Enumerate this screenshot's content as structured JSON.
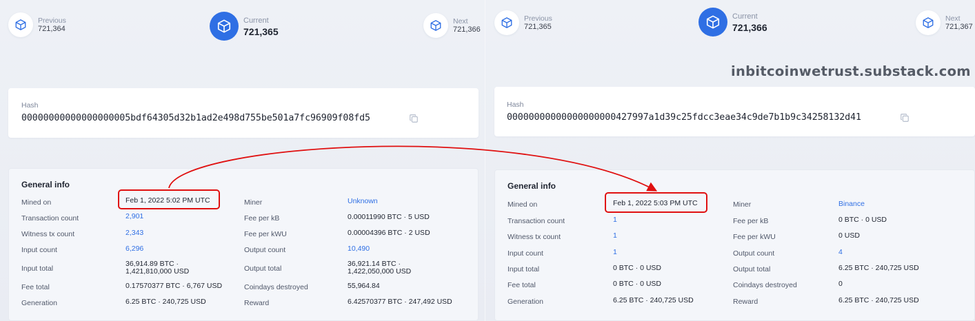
{
  "left": {
    "previous": {
      "label": "Previous",
      "number": "721,364"
    },
    "current": {
      "label": "Current",
      "number": "721,365"
    },
    "next": {
      "label": "Next",
      "number": "721,366"
    },
    "hash": {
      "label": "Hash",
      "value": "00000000000000000005bdf64305d32b1ad2e498d755be501a7fc96909f08fd5"
    },
    "general_info": {
      "title": "General info",
      "mined_on": {
        "key": "Mined on",
        "value": "Feb 1, 2022 5:02 PM UTC"
      },
      "rows_left": [
        {
          "key": "Transaction count",
          "value": "2,901"
        },
        {
          "key": "Witness tx count",
          "value": "2,343"
        },
        {
          "key": "Input count",
          "value": "6,296"
        },
        {
          "key": "Input total",
          "value1": "36,914.89 BTC ·",
          "value2": "1,421,810,000 USD"
        },
        {
          "key": "Fee total",
          "value": "0.17570377 BTC · 6,767 USD"
        },
        {
          "key": "Generation",
          "value": "6.25 BTC · 240,725 USD"
        }
      ],
      "rows_right": [
        {
          "key": "Miner",
          "value": "Unknown"
        },
        {
          "key": "Fee per kB",
          "value": "0.00011990 BTC · 5 USD"
        },
        {
          "key": "Fee per kWU",
          "value": "0.00004396 BTC · 2 USD"
        },
        {
          "key": "Output count",
          "value": "10,490"
        },
        {
          "key": "Output total",
          "value1": "36,921.14 BTC ·",
          "value2": "1,422,050,000 USD"
        },
        {
          "key": "Coindays destroyed",
          "value": "55,964.84"
        },
        {
          "key": "Reward",
          "value": "6.42570377 BTC · 247,492 USD"
        }
      ]
    }
  },
  "right": {
    "previous": {
      "label": "Previous",
      "number": "721,365"
    },
    "current": {
      "label": "Current",
      "number": "721,366"
    },
    "next": {
      "label": "Next",
      "number": "721,367"
    },
    "hash": {
      "label": "Hash",
      "value": "00000000000000000000427997a1d39c25fdcc3eae34c9de7b1b9c34258132d41"
    },
    "general_info": {
      "title": "General info",
      "mined_on": {
        "key": "Mined on",
        "value": "Feb 1, 2022 5:03 PM UTC"
      },
      "rows_left": [
        {
          "key": "Transaction count",
          "value": "1"
        },
        {
          "key": "Witness tx count",
          "value": "1"
        },
        {
          "key": "Input count",
          "value": "1"
        },
        {
          "key": "Input total",
          "value": "0 BTC · 0 USD"
        },
        {
          "key": "Fee total",
          "value": "0 BTC · 0 USD"
        },
        {
          "key": "Generation",
          "value": "6.25 BTC · 240,725 USD"
        }
      ],
      "rows_right": [
        {
          "key": "Miner",
          "value": "Binance"
        },
        {
          "key": "Fee per kB",
          "value": "0 BTC · 0 USD"
        },
        {
          "key": "Fee per kWU",
          "value": "0 USD"
        },
        {
          "key": "Output count",
          "value": "4"
        },
        {
          "key": "Output total",
          "value": "6.25 BTC · 240,725 USD"
        },
        {
          "key": "Coindays destroyed",
          "value": "0"
        },
        {
          "key": "Reward",
          "value": "6.25 BTC · 240,725 USD"
        }
      ]
    }
  },
  "watermark": "inbitcoinwetrust.substack.com",
  "colors": {
    "accent": "#2f6fe4",
    "highlight": "#e01010",
    "background": "#eceff5"
  },
  "icons": {
    "block": "cube-icon",
    "copy": "copy-icon"
  }
}
